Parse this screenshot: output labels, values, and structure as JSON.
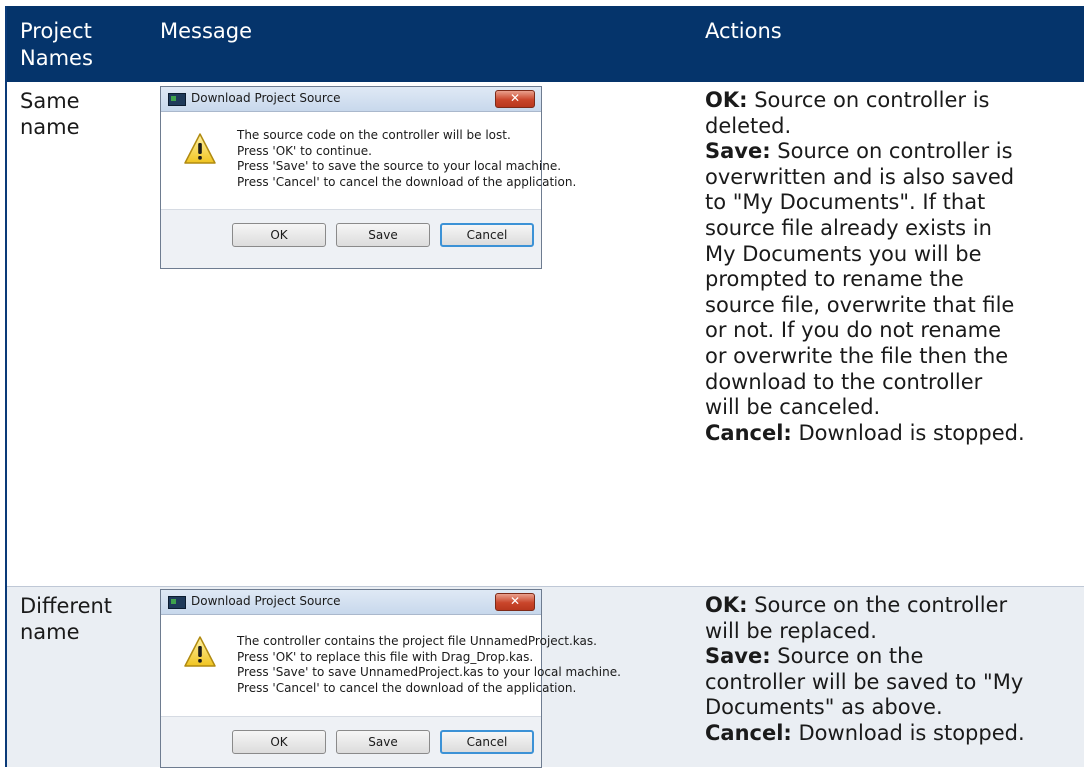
{
  "table": {
    "headers": {
      "names": "Project Names",
      "message": "Message",
      "actions": "Actions"
    },
    "rows": [
      {
        "name_lines": [
          "Same",
          "name"
        ],
        "dialog": {
          "title": "Download Project Source",
          "close": "✕",
          "message_lines": [
            "The source code on the controller will be lost.",
            "Press 'OK' to continue.",
            "Press 'Save' to save the source to your local machine.",
            "Press 'Cancel' to cancel the download of the application."
          ],
          "buttons": {
            "ok": "OK",
            "save": "Save",
            "cancel": "Cancel"
          }
        },
        "actions": {
          "ok_label": "OK:",
          "ok_text": " Source on controller is",
          "ok_cont": "deleted.",
          "save_label": "Save:",
          "save_lines": [
            " Source on controller is",
            "overwritten and is also saved",
            "to \"My Documents\". If that",
            "source file already exists in",
            "My Documents you will be",
            "prompted to rename the",
            "source file, overwrite that file",
            "or not. If you do not rename",
            "or overwrite the file then the",
            "download to the controller",
            "will be canceled."
          ],
          "cancel_label": "Cancel:",
          "cancel_text": " Download is stopped."
        }
      },
      {
        "name_lines": [
          "Different",
          "name"
        ],
        "dialog": {
          "title": "Download Project Source",
          "close": "✕",
          "message_lines": [
            "The controller contains the project file UnnamedProject.kas.",
            "Press 'OK' to replace this file with Drag_Drop.kas.",
            "Press 'Save' to save UnnamedProject.kas to your local machine.",
            "Press 'Cancel' to cancel the download of the application."
          ],
          "buttons": {
            "ok": "OK",
            "save": "Save",
            "cancel": "Cancel"
          }
        },
        "actions": {
          "ok_label": "OK:",
          "ok_text": " Source on the controller",
          "ok_cont": "will be replaced.",
          "save_label": "Save:",
          "save_lines": [
            " Source on the",
            "controller will be saved to \"My",
            "Documents\" as above."
          ],
          "cancel_label": "Cancel:",
          "cancel_text": " Download is stopped."
        }
      }
    ]
  },
  "colors": {
    "header_bg": "#05346b",
    "alt_row_bg": "#eaeef3",
    "dialog_close": "#c9452a"
  },
  "icons": {
    "warning": "warning-icon",
    "app": "app-icon",
    "close": "close-icon"
  }
}
